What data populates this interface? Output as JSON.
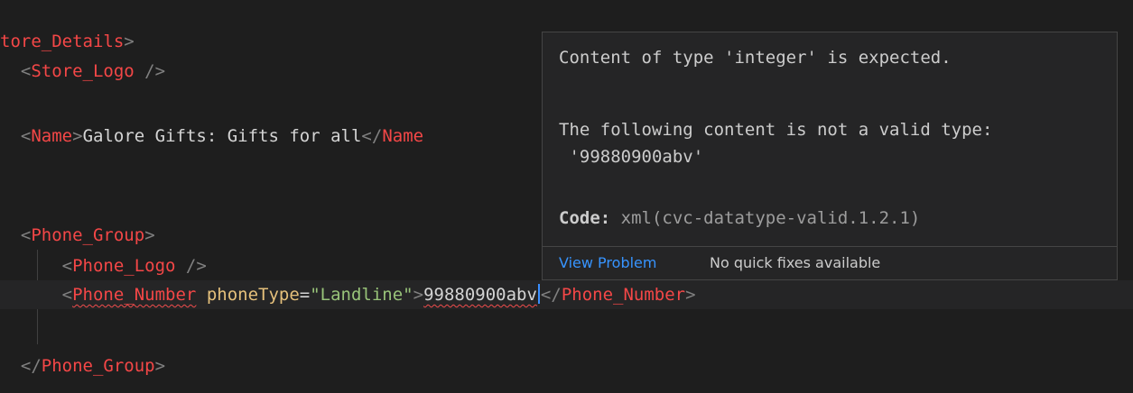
{
  "editor": {
    "line1": {
      "tag": "tore_Details",
      "close": ">"
    },
    "line2": {
      "open": "<",
      "tag": "Store_Logo",
      "close": " />"
    },
    "line3": {
      "open": "<",
      "tag": "Name",
      "gt": ">",
      "text": "Galore Gifts: Gifts for all",
      "endopen": "</",
      "endtag": "Name"
    },
    "line4": {
      "open": "<",
      "tag": "Phone_Group",
      "close": ">"
    },
    "line5": {
      "open": "<",
      "tag": "Phone_Logo",
      "close": " />"
    },
    "line6": {
      "open": "<",
      "tag": "Phone_Number",
      "attr": "phoneType",
      "eq": "=",
      "val": "\"Landline\"",
      "gt": ">",
      "text": "99880900abv",
      "endopen": "</",
      "endtag": "Phone_Number",
      "endclose": ">"
    },
    "line7": {
      "open": "</",
      "tag": "Phone_Group",
      "close": ">"
    }
  },
  "hover": {
    "message1": "Content of type 'integer' is expected.",
    "message2a": "The following content is not a valid type:",
    "message2b": " '99880900abv'",
    "code_label": "Code:",
    "code_value": " xml(cvc-datatype-valid.1.2.1)",
    "view_problem": "View Problem",
    "no_quick_fixes": "No quick fixes available"
  },
  "colors": {
    "background": "#1e1e1e",
    "tag": "#f44747",
    "string": "#98c379",
    "attribute": "#e5c07b",
    "link": "#3794ff",
    "error_squiggle": "#f14c4c"
  }
}
